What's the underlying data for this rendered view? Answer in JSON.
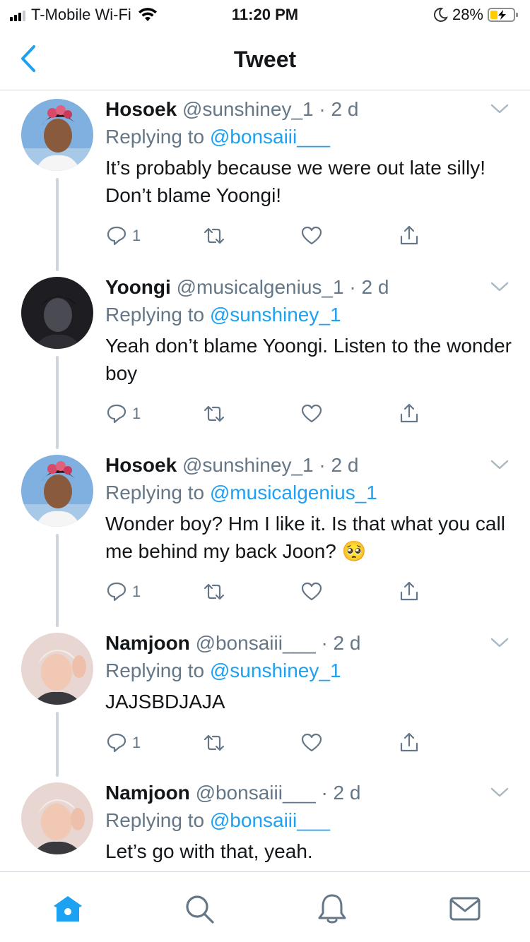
{
  "status_bar": {
    "carrier": "T-Mobile Wi-Fi",
    "time": "11:20 PM",
    "battery": "28%"
  },
  "nav": {
    "title": "Tweet",
    "back_icon": "chevron-left-icon"
  },
  "tweets": [
    {
      "name": "Hosoek",
      "handle": "@sunshiney_1",
      "time": "· 2 d",
      "replying_label": "Replying to",
      "replying_to": "@bonsaiii___",
      "text": "It’s probably because we were out late silly! Don’t blame Yoongi!",
      "reply_count": "1"
    },
    {
      "name": "Yoongi",
      "handle": "@musicalgenius_1",
      "time": "· 2 d",
      "replying_label": "Replying to",
      "replying_to": "@sunshiney_1",
      "text": "Yeah don’t blame Yoongi. Listen to the wonder boy",
      "reply_count": "1"
    },
    {
      "name": "Hosoek",
      "handle": "@sunshiney_1",
      "time": "· 2 d",
      "replying_label": "Replying to",
      "replying_to": "@musicalgenius_1",
      "text": "Wonder boy? Hm I like it. Is that what you call me behind my back Joon? 🥺",
      "reply_count": "1"
    },
    {
      "name": "Namjoon",
      "handle": "@bonsaiii___",
      "time": "· 2 d",
      "replying_label": "Replying to",
      "replying_to": "@sunshiney_1",
      "text": "JAJSBDJAJA",
      "reply_count": "1"
    },
    {
      "name": "Namjoon",
      "handle": "@bonsaiii___",
      "time": "· 2 d",
      "replying_label": "Replying to",
      "replying_to": "@bonsaiii___",
      "text": "Let’s go with that, yeah."
    }
  ],
  "tab_bar": {
    "items": [
      "home-icon",
      "search-icon",
      "notifications-icon",
      "messages-icon"
    ]
  },
  "colors": {
    "accent": "#1da1f2",
    "secondary_text": "#657786",
    "divider": "#d0d6db"
  }
}
